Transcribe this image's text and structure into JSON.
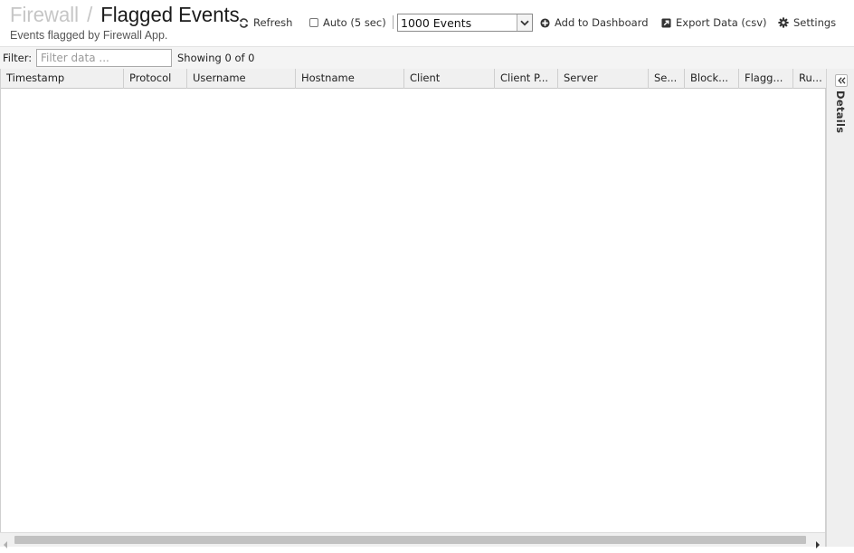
{
  "header": {
    "breadcrumb_parent": "Firewall",
    "breadcrumb_separator": "/",
    "title": "Flagged Events",
    "subtitle": "Events flagged by Firewall App."
  },
  "toolbar": {
    "refresh_label": "Refresh",
    "auto_label": "Auto (5 sec)",
    "auto_checked": false,
    "events_limit_selected": "1000 Events",
    "add_dashboard_label": "Add to Dashboard",
    "export_label": "Export Data (csv)",
    "settings_label": "Settings"
  },
  "filter": {
    "label": "Filter:",
    "placeholder": "Filter data ...",
    "value": "",
    "showing_text": "Showing 0 of 0"
  },
  "grid": {
    "columns": [
      {
        "label": "Timestamp"
      },
      {
        "label": "Protocol"
      },
      {
        "label": "Username"
      },
      {
        "label": "Hostname"
      },
      {
        "label": "Client"
      },
      {
        "label": "Client P..."
      },
      {
        "label": "Server"
      },
      {
        "label": "Se..."
      },
      {
        "label": "Block..."
      },
      {
        "label": "Flagg..."
      },
      {
        "label": "Ru..."
      }
    ],
    "rows": []
  },
  "details_panel": {
    "label": "Details",
    "collapsed": true
  },
  "colors": {
    "breadcrumb_parent": "#c6c6c6",
    "header_bg": "#f0f0f0",
    "scroll_thumb": "#c1c1c1"
  }
}
